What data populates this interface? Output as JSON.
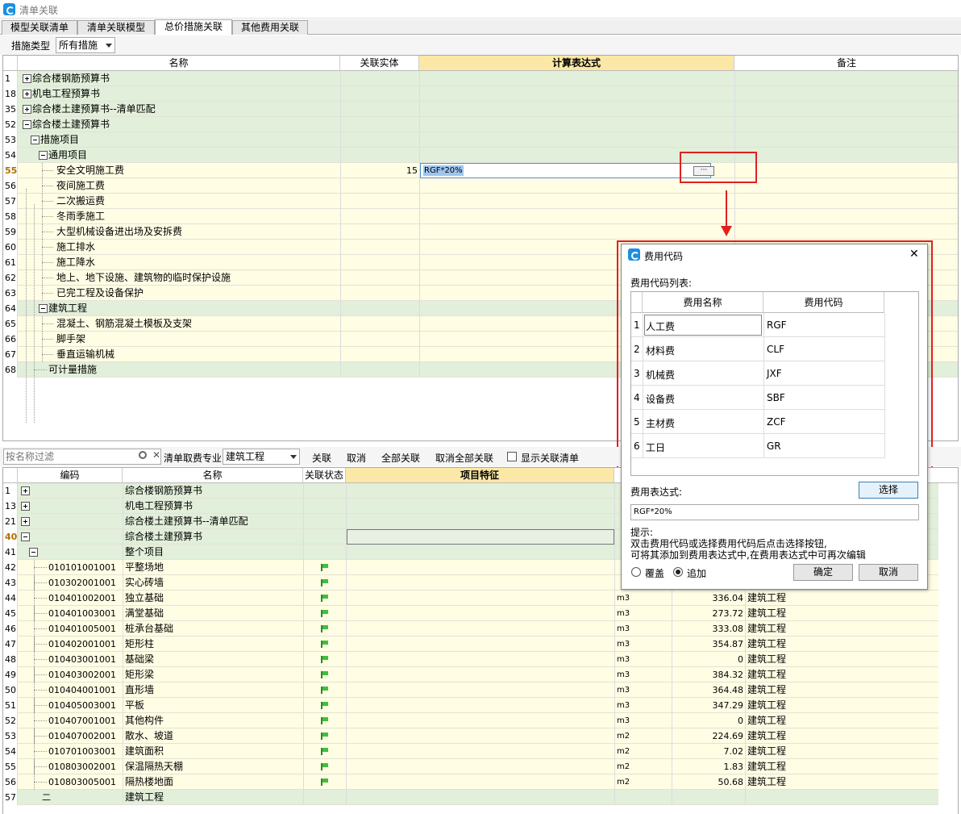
{
  "window": {
    "title": "清单关联"
  },
  "tabs": [
    {
      "label": "模型关联清单"
    },
    {
      "label": "清单关联模型"
    },
    {
      "label": "总价措施关联"
    },
    {
      "label": "其他费用关联"
    }
  ],
  "filter1": {
    "label": "措施类型",
    "value": "所有措施"
  },
  "top_grid": {
    "columns": [
      "名称",
      "关联实体",
      "计算表达式",
      "备注"
    ],
    "rows": [
      {
        "num": "1",
        "name": "综合楼钢筋预算书",
        "level": 0,
        "exp": "plus",
        "entity": "",
        "expr": "",
        "style": "g"
      },
      {
        "num": "18",
        "name": "机电工程预算书",
        "level": 0,
        "exp": "plus",
        "entity": "",
        "expr": "",
        "style": "g"
      },
      {
        "num": "35",
        "name": "综合楼土建预算书--清单匹配",
        "level": 0,
        "exp": "plus",
        "entity": "",
        "expr": "",
        "style": "g"
      },
      {
        "num": "52",
        "name": "综合楼土建预算书",
        "level": 0,
        "exp": "minus",
        "entity": "",
        "expr": "",
        "style": "g"
      },
      {
        "num": "53",
        "name": "措施项目",
        "level": 1,
        "exp": "minus",
        "entity": "",
        "expr": "",
        "style": "g"
      },
      {
        "num": "54",
        "name": "通用项目",
        "level": 2,
        "exp": "minus",
        "entity": "",
        "expr": "",
        "style": "g"
      },
      {
        "num": "55",
        "name": "安全文明施工费",
        "level": 3,
        "exp": "",
        "entity": "15",
        "expr": "RGF*20%",
        "style": "y",
        "sel": true
      },
      {
        "num": "56",
        "name": "夜间施工费",
        "level": 3,
        "exp": "",
        "entity": "",
        "expr": "",
        "style": "y"
      },
      {
        "num": "57",
        "name": "二次搬运费",
        "level": 3,
        "exp": "",
        "entity": "",
        "expr": "",
        "style": "y"
      },
      {
        "num": "58",
        "name": "冬雨季施工",
        "level": 3,
        "exp": "",
        "entity": "",
        "expr": "",
        "style": "y"
      },
      {
        "num": "59",
        "name": "大型机械设备进出场及安拆费",
        "level": 3,
        "exp": "",
        "entity": "",
        "expr": "",
        "style": "y"
      },
      {
        "num": "60",
        "name": "施工排水",
        "level": 3,
        "exp": "",
        "entity": "",
        "expr": "",
        "style": "y"
      },
      {
        "num": "61",
        "name": "施工降水",
        "level": 3,
        "exp": "",
        "entity": "",
        "expr": "",
        "style": "y"
      },
      {
        "num": "62",
        "name": "地上、地下设施、建筑物的临时保护设施",
        "level": 3,
        "exp": "",
        "entity": "",
        "expr": "",
        "style": "y"
      },
      {
        "num": "63",
        "name": "已完工程及设备保护",
        "level": 3,
        "exp": "",
        "entity": "",
        "expr": "",
        "style": "y"
      },
      {
        "num": "64",
        "name": "建筑工程",
        "level": 2,
        "exp": "minus",
        "entity": "",
        "expr": "",
        "style": "g"
      },
      {
        "num": "65",
        "name": "混凝土、钢筋混凝土模板及支架",
        "level": 3,
        "exp": "",
        "entity": "",
        "expr": "",
        "style": "y"
      },
      {
        "num": "66",
        "name": "脚手架",
        "level": 3,
        "exp": "",
        "entity": "",
        "expr": "",
        "style": "y"
      },
      {
        "num": "67",
        "name": "垂直运输机械",
        "level": 3,
        "exp": "",
        "entity": "",
        "expr": "",
        "style": "y"
      },
      {
        "num": "68",
        "name": "可计量措施",
        "level": 2,
        "exp": "",
        "entity": "",
        "expr": "",
        "style": "g"
      }
    ]
  },
  "ellipsis": "···",
  "toolbar2": {
    "search_placeholder": "按名称过滤",
    "spec_label": "清单取费专业",
    "spec_value": "建筑工程",
    "link": "关联",
    "cancel": "取消",
    "link_all": "全部关联",
    "cancel_all": "取消全部关联",
    "show_linked": "显示关联清单"
  },
  "bottom_grid": {
    "columns": [
      "编码",
      "名称",
      "关联状态",
      "项目特征"
    ],
    "rows": [
      {
        "num": "1",
        "code": "",
        "name": "综合楼钢筋预算书",
        "exp": "plus",
        "unit": "",
        "qty": "",
        "spec": "",
        "style": "g"
      },
      {
        "num": "13",
        "code": "",
        "name": "机电工程预算书",
        "exp": "plus",
        "unit": "",
        "qty": "",
        "spec": "",
        "style": "g"
      },
      {
        "num": "21",
        "code": "",
        "name": "综合楼土建预算书--清单匹配",
        "exp": "plus",
        "unit": "",
        "qty": "",
        "spec": "",
        "style": "g"
      },
      {
        "num": "40",
        "code": "",
        "name": "综合楼土建预算书",
        "exp": "minus",
        "unit": "",
        "qty": "",
        "spec": "",
        "style": "g",
        "sel": true
      },
      {
        "num": "41",
        "code": "",
        "name": "整个项目",
        "exp": "minus2",
        "unit": "",
        "qty": "",
        "spec": "",
        "style": "g"
      },
      {
        "num": "42",
        "code": "010101001001",
        "name": "平整场地",
        "flag": true,
        "unit": "",
        "qty": "",
        "spec": "",
        "style": "y"
      },
      {
        "num": "43",
        "code": "010302001001",
        "name": "实心砖墙",
        "flag": true,
        "unit": "",
        "qty": "",
        "spec": "",
        "style": "y"
      },
      {
        "num": "44",
        "code": "010401002001",
        "name": "独立基础",
        "flag": true,
        "unit": "m3",
        "qty": "336.04",
        "spec": "建筑工程",
        "style": "y"
      },
      {
        "num": "45",
        "code": "010401003001",
        "name": "满堂基础",
        "flag": true,
        "unit": "m3",
        "qty": "273.72",
        "spec": "建筑工程",
        "style": "y"
      },
      {
        "num": "46",
        "code": "010401005001",
        "name": "桩承台基础",
        "flag": true,
        "unit": "m3",
        "qty": "333.08",
        "spec": "建筑工程",
        "style": "y"
      },
      {
        "num": "47",
        "code": "010402001001",
        "name": "矩形柱",
        "flag": true,
        "unit": "m3",
        "qty": "354.87",
        "spec": "建筑工程",
        "style": "y"
      },
      {
        "num": "48",
        "code": "010403001001",
        "name": "基础梁",
        "flag": true,
        "unit": "m3",
        "qty": "0",
        "spec": "建筑工程",
        "style": "y"
      },
      {
        "num": "49",
        "code": "010403002001",
        "name": "矩形梁",
        "flag": true,
        "unit": "m3",
        "qty": "384.32",
        "spec": "建筑工程",
        "style": "y"
      },
      {
        "num": "50",
        "code": "010404001001",
        "name": "直形墙",
        "flag": true,
        "unit": "m3",
        "qty": "364.48",
        "spec": "建筑工程",
        "style": "y"
      },
      {
        "num": "51",
        "code": "010405003001",
        "name": "平板",
        "flag": true,
        "unit": "m3",
        "qty": "347.29",
        "spec": "建筑工程",
        "style": "y"
      },
      {
        "num": "52",
        "code": "010407001001",
        "name": "其他构件",
        "flag": true,
        "unit": "m3",
        "qty": "0",
        "spec": "建筑工程",
        "style": "y"
      },
      {
        "num": "53",
        "code": "010407002001",
        "name": "散水、坡道",
        "flag": true,
        "unit": "m2",
        "qty": "224.69",
        "spec": "建筑工程",
        "style": "y"
      },
      {
        "num": "54",
        "code": "010701003001",
        "name": "建筑面积",
        "flag": true,
        "unit": "m2",
        "qty": "7.02",
        "spec": "建筑工程",
        "style": "y"
      },
      {
        "num": "55",
        "code": "010803002001",
        "name": "保温隔热天棚",
        "flag": true,
        "unit": "m2",
        "qty": "1.83",
        "spec": "建筑工程",
        "style": "y"
      },
      {
        "num": "56",
        "code": "010803005001",
        "name": "隔热楼地面",
        "flag": true,
        "unit": "m2",
        "qty": "50.68",
        "spec": "建筑工程",
        "style": "y"
      },
      {
        "num": "57",
        "code": "二",
        "name": "建筑工程",
        "unit": "",
        "qty": "",
        "spec": "",
        "style": "g"
      }
    ]
  },
  "dialog": {
    "title": "费用代码",
    "close": "✕",
    "list_label": "费用代码列表:",
    "columns": [
      "费用名称",
      "费用代码"
    ],
    "rows": [
      {
        "num": "1",
        "name": "人工费",
        "code": "RGF"
      },
      {
        "num": "2",
        "name": "材料费",
        "code": "CLF"
      },
      {
        "num": "3",
        "name": "机械费",
        "code": "JXF"
      },
      {
        "num": "4",
        "name": "设备费",
        "code": "SBF"
      },
      {
        "num": "5",
        "name": "主材费",
        "code": "ZCF"
      },
      {
        "num": "6",
        "name": "工日",
        "code": "GR"
      }
    ],
    "expr_label": "费用表达式:",
    "select_btn": "选择",
    "expr_value": "RGF*20%",
    "hint_title": "提示:",
    "hint_line1": "双击费用代码或选择费用代码后点击选择按钮,",
    "hint_line2": "可将其添加到费用表达式中,在费用表达式中可再次编辑",
    "radio_overwrite": "覆盖",
    "radio_append": "追加",
    "ok": "确定",
    "cancel": "取消"
  },
  "colors": {
    "group_row": "#e2efda",
    "item_row": "#fffde4",
    "highlight_header": "#fbe8a6",
    "annotation_red": "#e02020"
  }
}
